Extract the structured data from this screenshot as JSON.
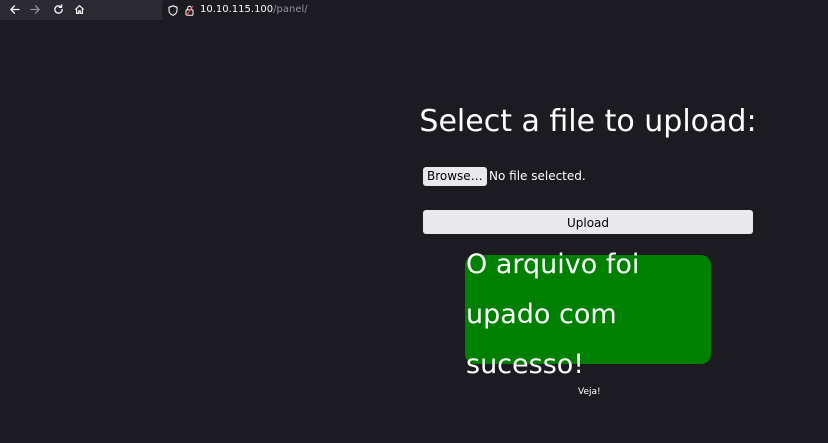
{
  "browser": {
    "url_host": "10.10.115.100",
    "url_path": "/panel/",
    "icons": {
      "back": "arrow-left-icon",
      "forward": "arrow-right-icon",
      "reload": "reload-icon",
      "home": "home-icon",
      "shield": "shield-icon",
      "lock": "lock-icon"
    }
  },
  "page": {
    "heading": "Select a file to upload:",
    "browse_label": "Browse…",
    "file_status": "No file selected.",
    "upload_label": "Upload",
    "success_message": "O arquivo foi upado com sucesso!",
    "link_text": "Veja!"
  },
  "colors": {
    "background": "#1c1b22",
    "success": "#008000",
    "button": "#e9e9ed",
    "text": "#ffffff"
  }
}
